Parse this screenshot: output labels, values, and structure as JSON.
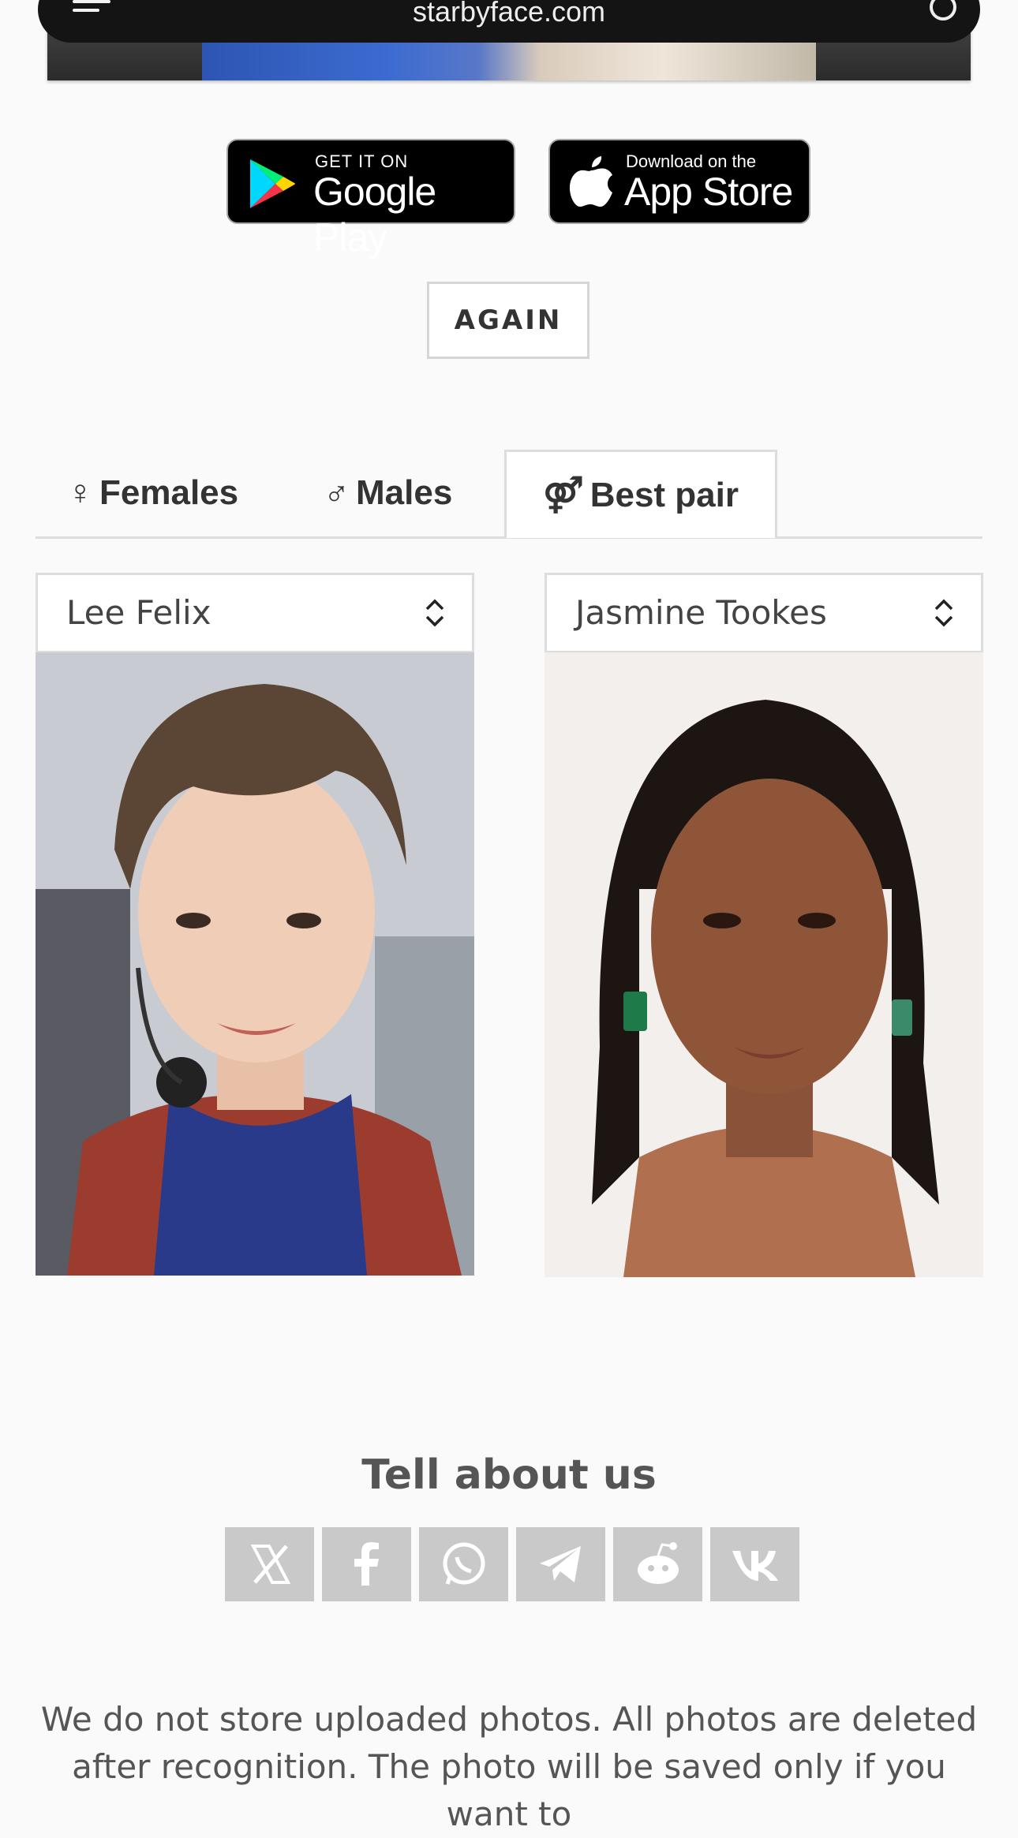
{
  "browser": {
    "url": "starbyface.com"
  },
  "stores": {
    "google_small": "GET IT ON",
    "google_big": "Google Play",
    "apple_small": "Download on the",
    "apple_big": "App Store"
  },
  "again_label": "AGAIN",
  "tabs": [
    {
      "symbol": "♀",
      "label": "Females",
      "active": false
    },
    {
      "symbol": "♂",
      "label": "Males",
      "active": false
    },
    {
      "symbol": "⚤",
      "label": "Best pair",
      "active": true
    }
  ],
  "pair": {
    "left_select": "Lee Felix",
    "right_select": "Jasmine Tookes"
  },
  "share": {
    "title": "Tell about us",
    "buttons": [
      "x-icon",
      "facebook-icon",
      "whatsapp-icon",
      "telegram-icon",
      "reddit-icon",
      "vk-icon"
    ]
  },
  "disclaimer": "We do not store uploaded photos. All photos are deleted after recognition. The photo will be saved only if you want to"
}
